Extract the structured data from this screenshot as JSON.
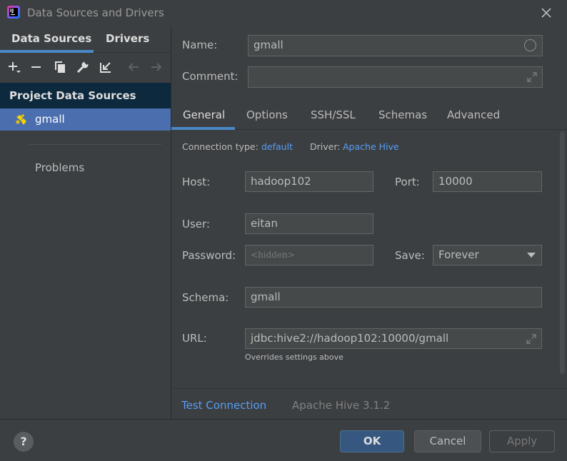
{
  "window": {
    "title": "Data Sources and Drivers",
    "app_icon": "intellij-icon",
    "close_icon": "close-icon"
  },
  "left": {
    "tabs": [
      {
        "label": "Data Sources"
      },
      {
        "label": "Drivers"
      }
    ],
    "toolbar": [
      "add-icon",
      "remove-icon",
      "duplicate-icon",
      "wrench-icon",
      "import-icon",
      "back-arrow-icon",
      "forward-arrow-icon"
    ],
    "section": "Project Data Sources",
    "items": [
      {
        "label": "gmall",
        "icon": "hive-icon"
      }
    ],
    "problems": "Problems"
  },
  "form": {
    "name_label": "Name:",
    "name_value": "gmall",
    "comment_label": "Comment:",
    "comment_value": ""
  },
  "tabs": [
    {
      "label": "General"
    },
    {
      "label": "Options"
    },
    {
      "label": "SSH/SSL"
    },
    {
      "label": "Schemas"
    },
    {
      "label": "Advanced"
    }
  ],
  "general": {
    "conn_type_label": "Connection type:",
    "conn_type_value": "default",
    "driver_label": "Driver:",
    "driver_value": "Apache Hive",
    "host_label": "Host:",
    "host_value": "hadoop102",
    "port_label": "Port:",
    "port_value": "10000",
    "user_label": "User:",
    "user_value": "eitan",
    "password_label": "Password:",
    "password_placeholder": "<hidden>",
    "save_label": "Save:",
    "save_value": "Forever",
    "schema_label": "Schema:",
    "schema_value": "gmall",
    "url_label": "URL:",
    "url_value": "jdbc:hive2://hadoop102:10000/gmall",
    "url_hint": "Overrides settings above"
  },
  "bottom": {
    "test_connection": "Test Connection",
    "driver_version": "Apache Hive 3.1.2"
  },
  "footer": {
    "help": "?",
    "ok": "OK",
    "cancel": "Cancel",
    "apply": "Apply"
  },
  "colors": {
    "accent": "#4a88c7",
    "link": "#589df6",
    "selection": "#4b6eaf",
    "section_bg": "#0d293e"
  }
}
